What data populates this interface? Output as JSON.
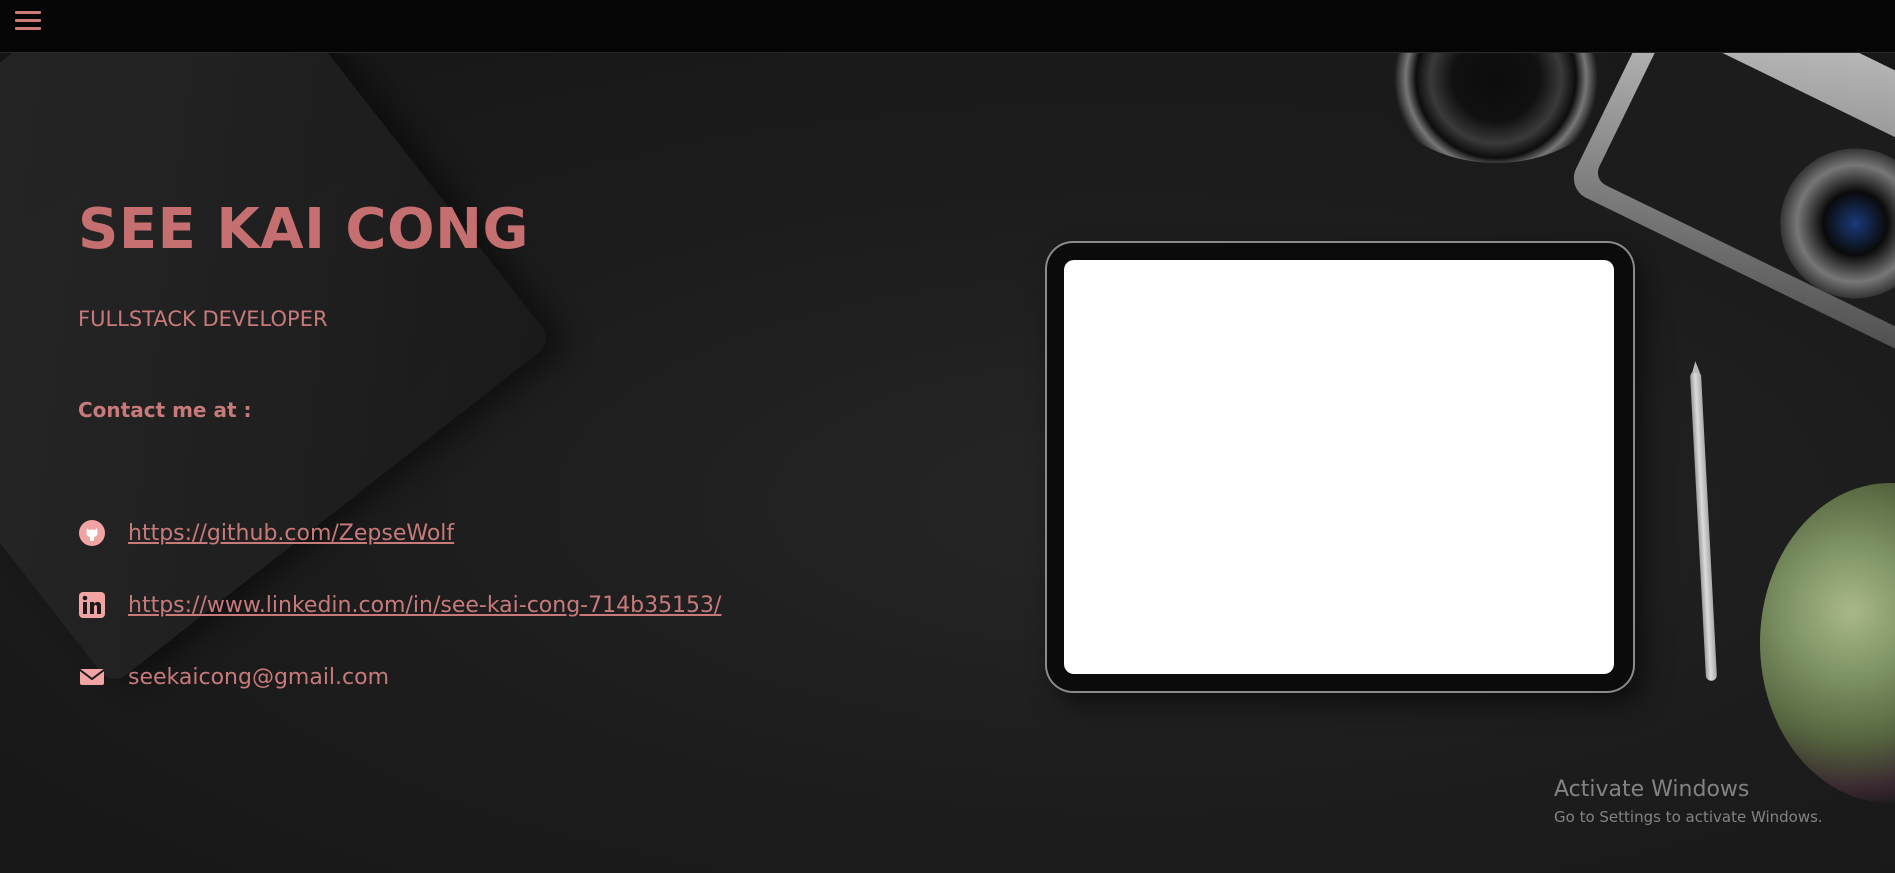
{
  "nav": {
    "menu_icon": "hamburger-menu-icon"
  },
  "hero": {
    "name": "SEE KAI CONG",
    "role": "FULLSTACK DEVELOPER",
    "contact_heading": "Contact me at :"
  },
  "contacts": [
    {
      "icon": "github-icon",
      "text": "https://github.com/ZepseWolf",
      "type": "link"
    },
    {
      "icon": "linkedin-icon",
      "text": "https://www.linkedin.com/in/see-kai-cong-714b35153/",
      "type": "link"
    },
    {
      "icon": "mail-icon",
      "text": "seekaicong@gmail.com",
      "type": "text"
    }
  ],
  "watermark": {
    "title": "Activate Windows",
    "subtitle": "Go to Settings to activate Windows."
  },
  "colors": {
    "accent": "#c56f70",
    "topbar": "#050505",
    "background": "#1b1b1b"
  }
}
